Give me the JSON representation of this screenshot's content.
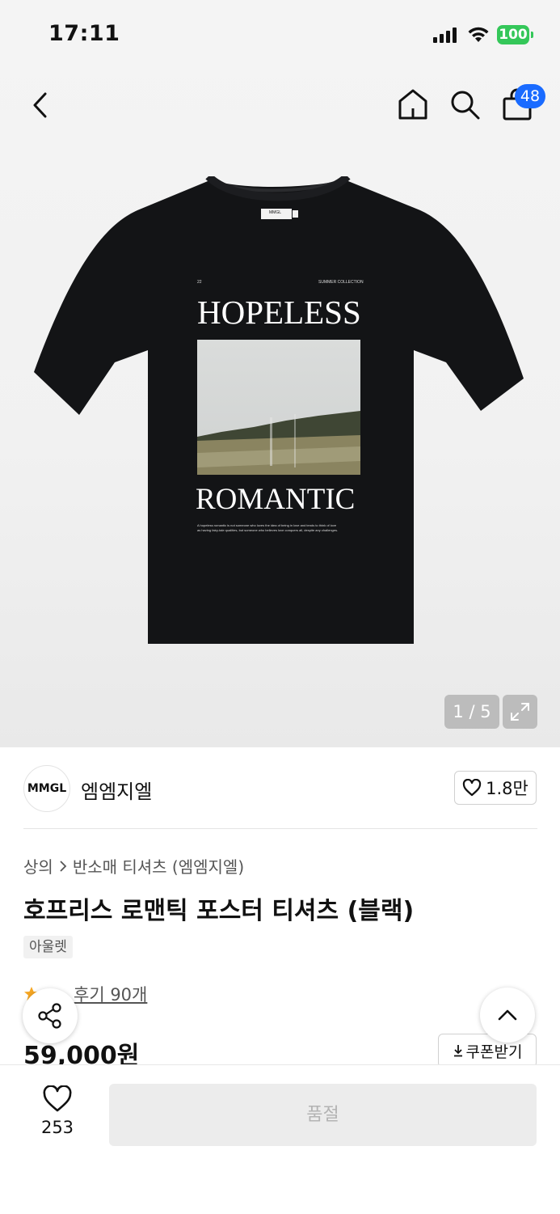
{
  "status_bar": {
    "time": "17:11",
    "battery": "100"
  },
  "nav": {
    "cart_count": "48"
  },
  "gallery": {
    "counter": "1 / 5",
    "shirt": {
      "label": "MMGL",
      "number": "22",
      "collection": "SUMMER COLLECTION",
      "line1": "HOPELESS",
      "line2": "ROMANTIC",
      "caption1": "A hopeless romantic is not someone who loves the idea of being in love and tends to think of love",
      "caption2": "as having fairy-tale qualities, but someone who believes love conquers all, despite any challenges."
    }
  },
  "brand": {
    "logo_text": "MMGL",
    "name": "엠엠지엘",
    "likes": "1.8만"
  },
  "breadcrumb": {
    "category": "상의",
    "subcategory": "반소매 티셔츠 (엠엠지엘)"
  },
  "product": {
    "title": "호프리스 로맨틱 포스터 티셔츠 (블랙)",
    "tag": "아울렛",
    "review": "후기 90개",
    "price": "59,000원"
  },
  "coupon_label": "쿠폰받기",
  "bottom_bar": {
    "wish_count": "253",
    "buy_label": "품절"
  },
  "colors": {
    "accent": "#1a6bff",
    "star": "#f5a623",
    "battery": "#34c759"
  }
}
